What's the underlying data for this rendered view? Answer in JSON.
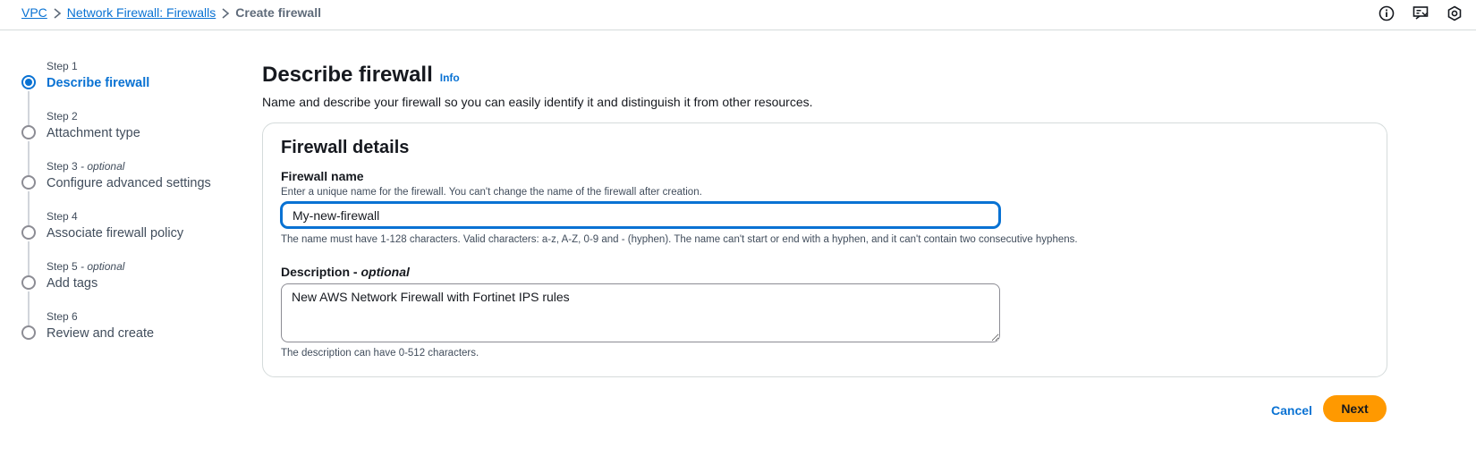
{
  "breadcrumb": {
    "items": [
      "VPC",
      "Network Firewall: Firewalls",
      "Create firewall"
    ]
  },
  "top_icons": [
    "info-icon",
    "feedback-icon",
    "settings-hex-icon"
  ],
  "steps": [
    {
      "num": "Step 1",
      "optional": "",
      "label": "Describe firewall",
      "active": true
    },
    {
      "num": "Step 2",
      "optional": "",
      "label": "Attachment type",
      "active": false
    },
    {
      "num": "Step 3",
      "optional": " - optional",
      "label": "Configure advanced settings",
      "active": false
    },
    {
      "num": "Step 4",
      "optional": "",
      "label": "Associate firewall policy",
      "active": false
    },
    {
      "num": "Step 5",
      "optional": " - optional",
      "label": "Add tags",
      "active": false
    },
    {
      "num": "Step 6",
      "optional": "",
      "label": "Review and create",
      "active": false
    }
  ],
  "page": {
    "title": "Describe firewall",
    "info": "Info",
    "description": "Name and describe your firewall so you can easily identify it and distinguish it from other resources."
  },
  "details": {
    "title": "Firewall details",
    "name_label": "Firewall name",
    "name_hint": "Enter a unique name for the firewall. You can't change the name of the firewall after creation.",
    "name_value": "My-new-firewall",
    "name_constraint": "The name must have 1-128 characters. Valid characters: a-z, A-Z, 0-9 and - (hyphen). The name can't start or end with a hyphen, and it can't contain two consecutive hyphens.",
    "desc_label": "Description -",
    "desc_optional": " optional",
    "desc_value": "New AWS Network Firewall with Fortinet IPS rules",
    "desc_constraint": "The description can have 0-512 characters."
  },
  "actions": {
    "cancel": "Cancel",
    "next": "Next"
  },
  "colors": {
    "link": "#0972d3",
    "primary_button": "#ff9900"
  }
}
